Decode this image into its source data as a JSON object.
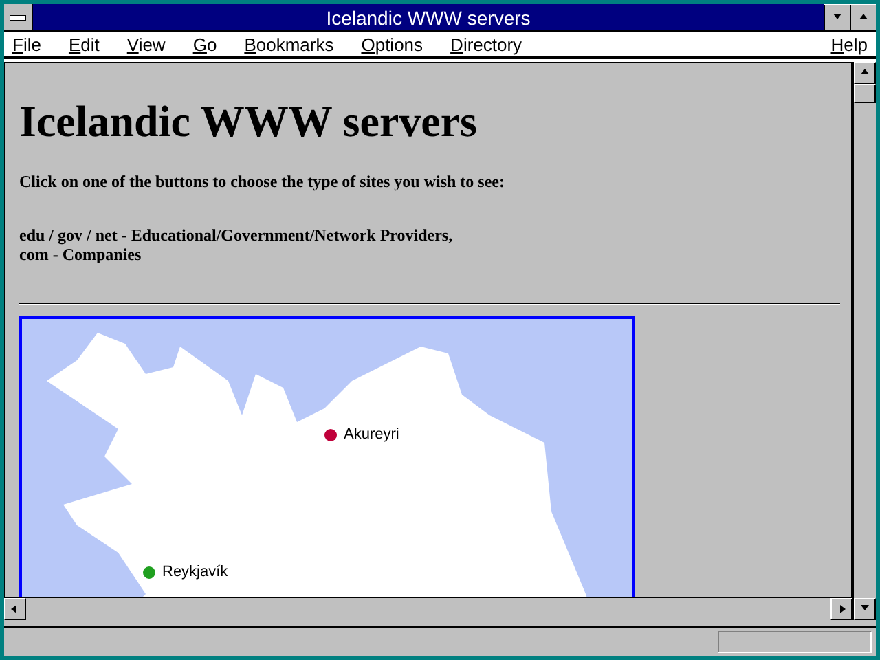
{
  "window": {
    "title": "Icelandic WWW servers"
  },
  "menu": [
    {
      "hotkey": "F",
      "rest": "ile"
    },
    {
      "hotkey": "E",
      "rest": "dit"
    },
    {
      "hotkey": "V",
      "rest": "iew"
    },
    {
      "hotkey": "G",
      "rest": "o"
    },
    {
      "hotkey": "B",
      "rest": "ookmarks"
    },
    {
      "hotkey": "O",
      "rest": "ptions"
    },
    {
      "hotkey": "D",
      "rest": "irectory"
    }
  ],
  "help_menu": {
    "hotkey": "H",
    "rest": "elp"
  },
  "page": {
    "heading": "Icelandic WWW servers",
    "intro": "Click on one of the buttons to choose the type of sites you wish to see:",
    "legend": [
      "edu / gov / net - Educational/Government/Network Providers,",
      "com - Companies"
    ]
  },
  "map": {
    "pins": [
      {
        "label": "Akureyri",
        "color": "#c0003a"
      },
      {
        "label": "Reykjavík",
        "color": "#20a020"
      }
    ]
  }
}
